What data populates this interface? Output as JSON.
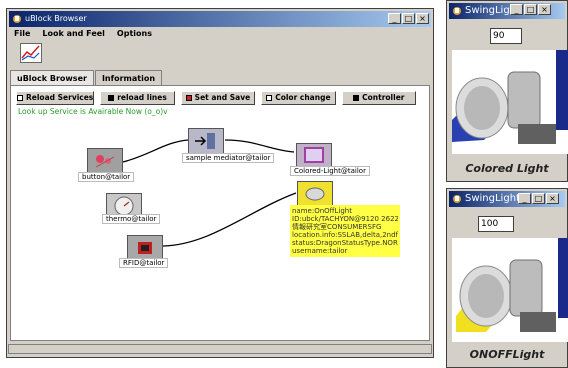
{
  "ublock": {
    "title": "uBlock Browser",
    "menu": [
      "File",
      "Look and Feel",
      "Options"
    ],
    "tabs": [
      "uBlock Browser",
      "Information"
    ],
    "buttons": [
      "Reload Services",
      "reload lines",
      "Set and Save",
      "Color change",
      "Controller"
    ],
    "button_colors": [
      "#ffffff",
      "#000000",
      "#cc2222",
      "#ffffff",
      "#000000"
    ],
    "status": "Look up Service is Avairable Now (o_o)v",
    "nodes": {
      "button": "button@tailor",
      "mediator": "sample mediator@tailor",
      "colored": "Colored-Light@tailor",
      "thermo": "thermo@tailor",
      "rfid": "RFID@tailor"
    },
    "info_lines": [
      "name:OnOffLight",
      "ID:ubck/TACHYON@9120 2622",
      "情報研究室CONSUMERSFG",
      "location.info:SSLAB,delta,2ndfloor",
      "status:DragonStatusType.NORMAL",
      "username:tailor"
    ]
  },
  "swing1": {
    "title": "SwingLight",
    "value": "90",
    "caption": "Colored Light",
    "beam_color": "#2840b0"
  },
  "swing2": {
    "title": "SwingLight",
    "value": "100",
    "caption": "ONOFFLight",
    "beam_color": "#f0e020"
  }
}
